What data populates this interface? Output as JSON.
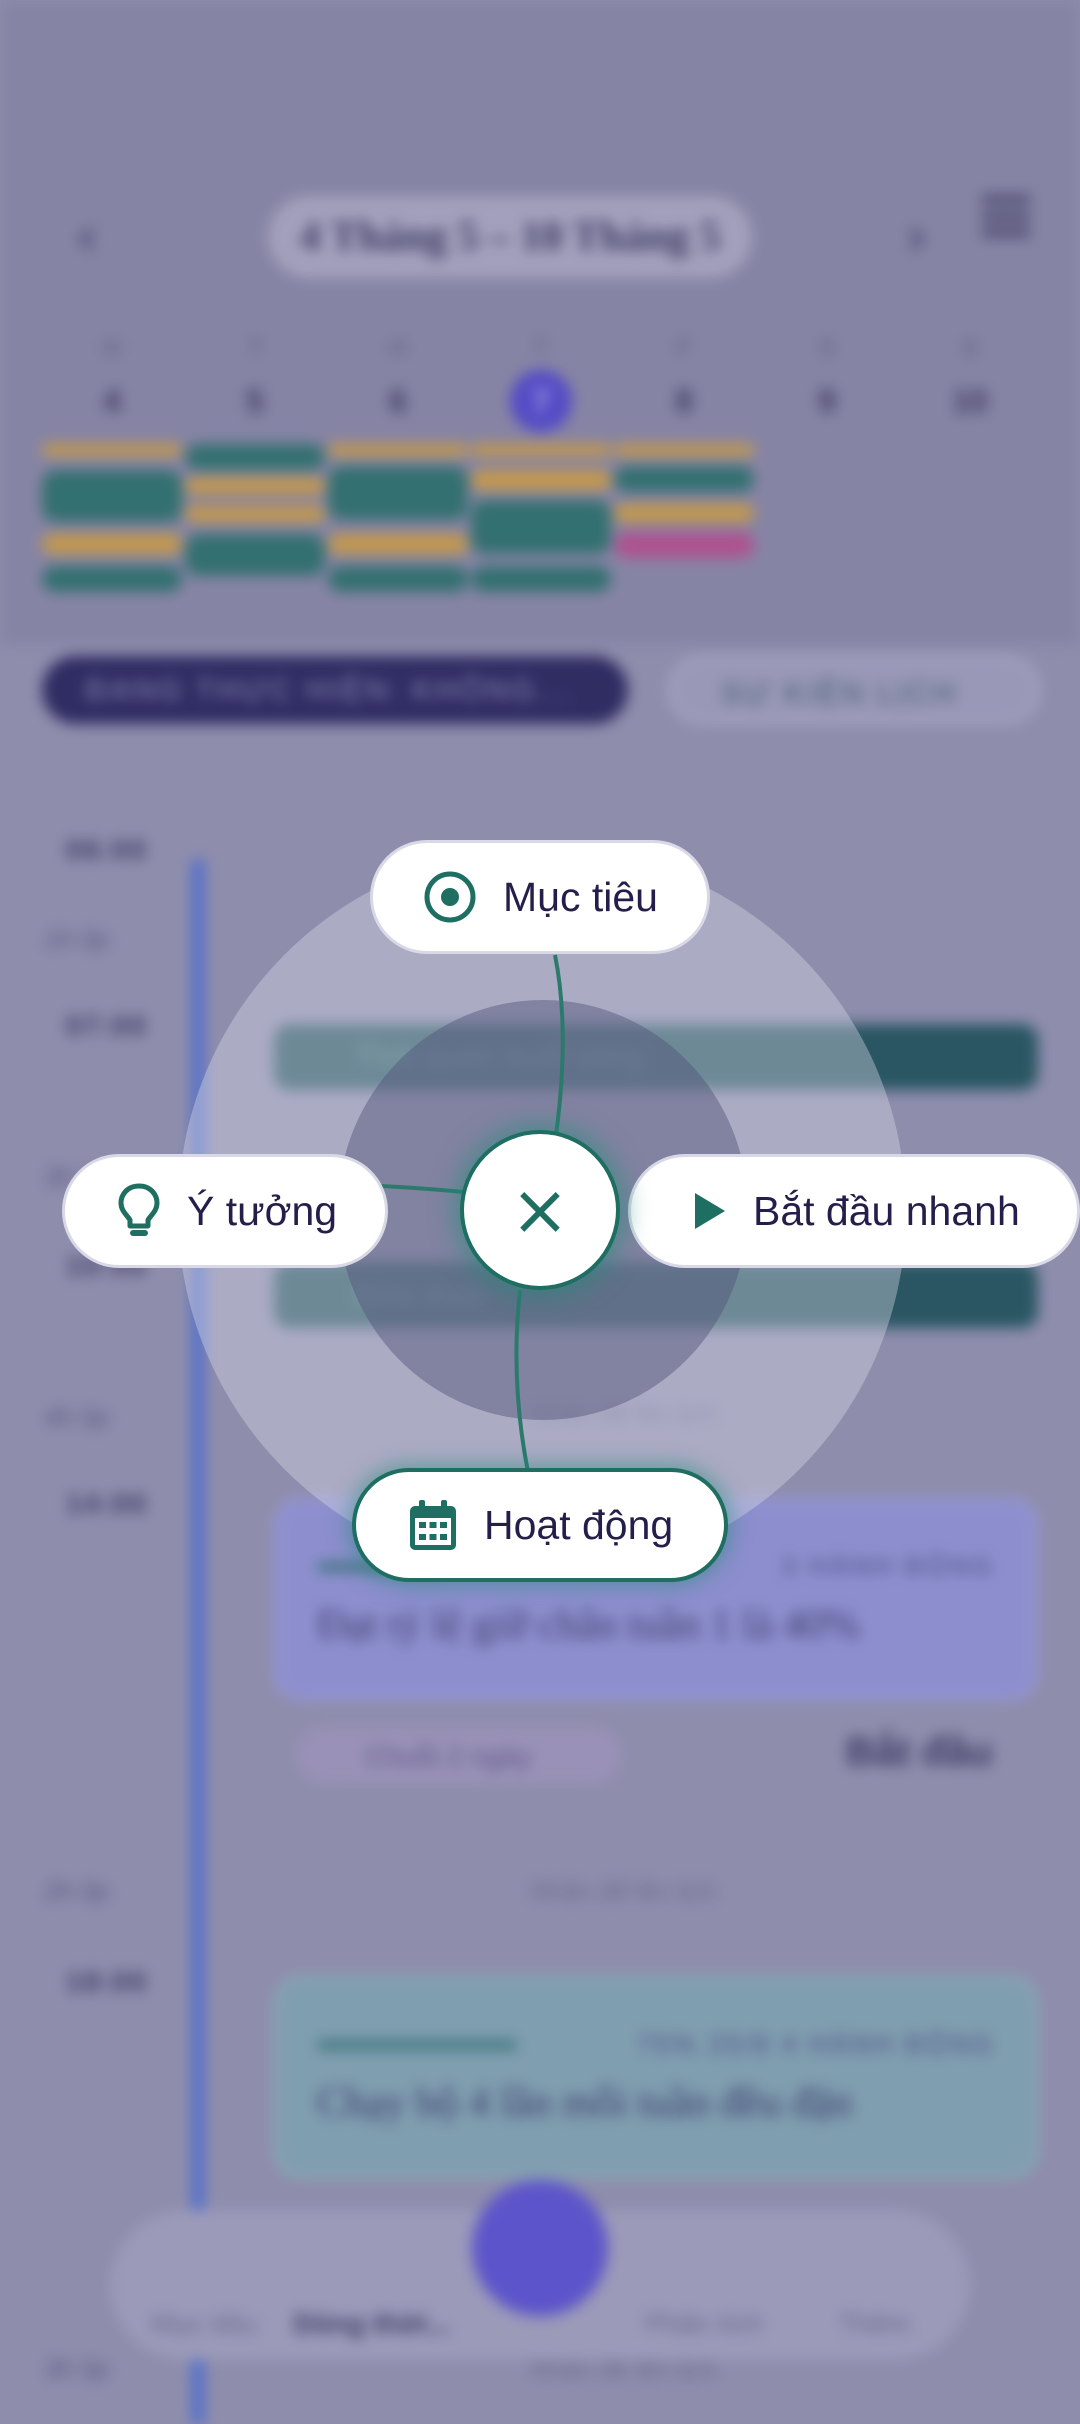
{
  "header": {
    "range_label": "4 Tháng 5 – 10 Tháng 5"
  },
  "week": {
    "letters": [
      "H",
      "T",
      "H",
      "T",
      "F",
      "S",
      "S"
    ],
    "days": [
      "4",
      "5",
      "6",
      "7",
      "8",
      "9",
      "10"
    ],
    "today": "7"
  },
  "status": {
    "running": "ĐANG THỰC HIỆN: KHÔNG...",
    "calendar_events": "SỰ KIỆN LỊCH"
  },
  "timeline": {
    "times": [
      "06:00",
      "07:00",
      "10:00",
      "14:00",
      "18:00"
    ],
    "durations": [
      "1h 0p",
      "3h 0p",
      "4h 0p",
      "2h 0p",
      "3h 0p"
    ],
    "events": [
      "Thói quen buổi sáng",
      "Bữa trưa"
    ],
    "add_prompt": "Nhấn để lên lịch"
  },
  "goals": [
    {
      "title": "Đạt tỷ lệ giữ chân tuần 1 là 40%",
      "meta": "3 HÀNH ĐỘNG"
    },
    {
      "title": "Chạy bộ 4 lần mỗi tuần đều đặn",
      "meta": "75%   25/8   4 HÀNH ĐỘNG"
    }
  ],
  "streak": "Chuỗi 2 ngày",
  "start_label": "Bắt đầu",
  "bottom_nav": [
    "Mục tiêu",
    "Dòng thời...",
    "Phân tích",
    "Thêm"
  ],
  "quick_actions": {
    "goal": "Mục tiêu",
    "idea": "Ý tưởng",
    "quick_start": "Bắt đầu nhanh",
    "activity": "Hoạt động",
    "close": "×"
  },
  "colors": {
    "accent": "#1e6e61",
    "fab": "#5a52cc",
    "today": "#5248c8"
  }
}
